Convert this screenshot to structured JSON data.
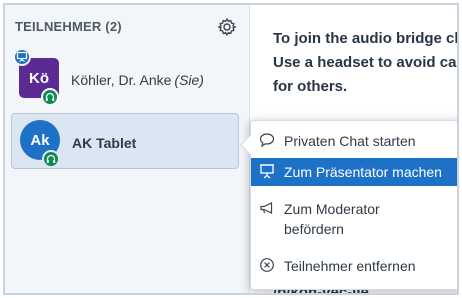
{
  "sidebar": {
    "title": "TEILNEHMER (2)",
    "settings_icon": "gear-icon",
    "users": [
      {
        "initials": "Kö",
        "name": "Köhler, Dr. Anke",
        "you_label": "(Sie)",
        "avatar_color": "#5b2b93",
        "is_presenter": true,
        "audio": "headset-icon"
      },
      {
        "initials": "Ak",
        "name": "AK Tablet",
        "avatar_color": "#1d71c6",
        "is_presenter": false,
        "audio": "headset-icon"
      }
    ]
  },
  "main": {
    "lines": [
      "To join the audio bridge cl",
      "Use a headset to avoid ca",
      "for others."
    ],
    "link_fragment": "/b/koh-vec-iie"
  },
  "context_menu": {
    "items": [
      {
        "icon": "chat-bubble-icon",
        "label": "Privaten Chat starten",
        "highlighted": false
      },
      {
        "icon": "presentation-screen-icon",
        "label": "Zum Präsentator machen",
        "highlighted": true
      },
      {
        "icon": "megaphone-icon",
        "label_line1": "Zum Moderator",
        "label_line2": "befördern",
        "highlighted": false
      },
      {
        "icon": "remove-circle-icon",
        "label": "Teilnehmer entfernen",
        "highlighted": false
      }
    ]
  },
  "colors": {
    "accent": "#1d71c6",
    "audio_badge": "#0e8a55",
    "sidebar_bg": "#f3f6f9",
    "selected_row": "#dbe6f2"
  }
}
